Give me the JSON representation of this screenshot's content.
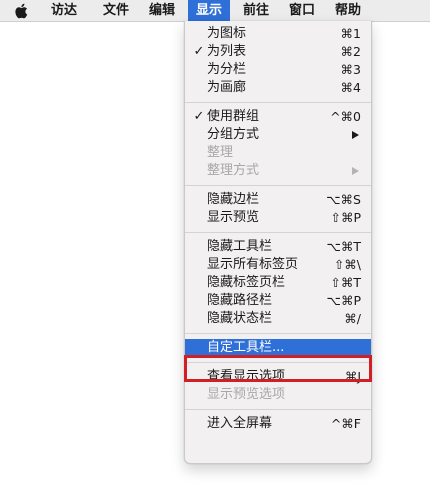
{
  "menubar": {
    "items": [
      {
        "label": "访达",
        "active": false
      },
      {
        "label": "文件",
        "active": false
      },
      {
        "label": "编辑",
        "active": false
      },
      {
        "label": "显示",
        "active": true
      },
      {
        "label": "前往",
        "active": false
      },
      {
        "label": "窗口",
        "active": false
      },
      {
        "label": "帮助",
        "active": false
      }
    ]
  },
  "menu": {
    "groups": [
      [
        {
          "label": "为图标",
          "shortcut": "⌘1",
          "checked": false,
          "disabled": false
        },
        {
          "label": "为列表",
          "shortcut": "⌘2",
          "checked": true,
          "disabled": false
        },
        {
          "label": "为分栏",
          "shortcut": "⌘3",
          "checked": false,
          "disabled": false
        },
        {
          "label": "为画廊",
          "shortcut": "⌘4",
          "checked": false,
          "disabled": false
        }
      ],
      [
        {
          "label": "使用群组",
          "shortcut": "^⌘0",
          "checked": true,
          "disabled": false
        },
        {
          "label": "分组方式",
          "submenu": true,
          "disabled": false
        },
        {
          "label": "整理",
          "disabled": true
        },
        {
          "label": "整理方式",
          "submenu": true,
          "disabled": true
        }
      ],
      [
        {
          "label": "隐藏边栏",
          "shortcut": "⌥⌘S",
          "disabled": false
        },
        {
          "label": "显示预览",
          "shortcut": "⇧⌘P",
          "disabled": false
        }
      ],
      [
        {
          "label": "隐藏工具栏",
          "shortcut": "⌥⌘T",
          "disabled": false
        },
        {
          "label": "显示所有标签页",
          "shortcut": "⇧⌘\\",
          "disabled": false
        },
        {
          "label": "隐藏标签页栏",
          "shortcut": "⇧⌘T",
          "disabled": false
        },
        {
          "label": "隐藏路径栏",
          "shortcut": "⌥⌘P",
          "disabled": false
        },
        {
          "label": "隐藏状态栏",
          "shortcut": "⌘/",
          "disabled": false
        }
      ],
      [
        {
          "label": "自定工具栏...",
          "highlighted": true,
          "disabled": false
        }
      ],
      [
        {
          "label": "查看显示选项",
          "shortcut": "⌘J",
          "disabled": false
        },
        {
          "label": "显示预览选项",
          "disabled": true
        }
      ],
      [
        {
          "label": "进入全屏幕",
          "shortcut": "^⌘F",
          "disabled": false
        }
      ]
    ]
  },
  "colors": {
    "accent": "#2f6fd8",
    "annotation": "#d11f26",
    "menu_bg": "#f2f0f0",
    "disabled_text": "#a8a8a8"
  }
}
